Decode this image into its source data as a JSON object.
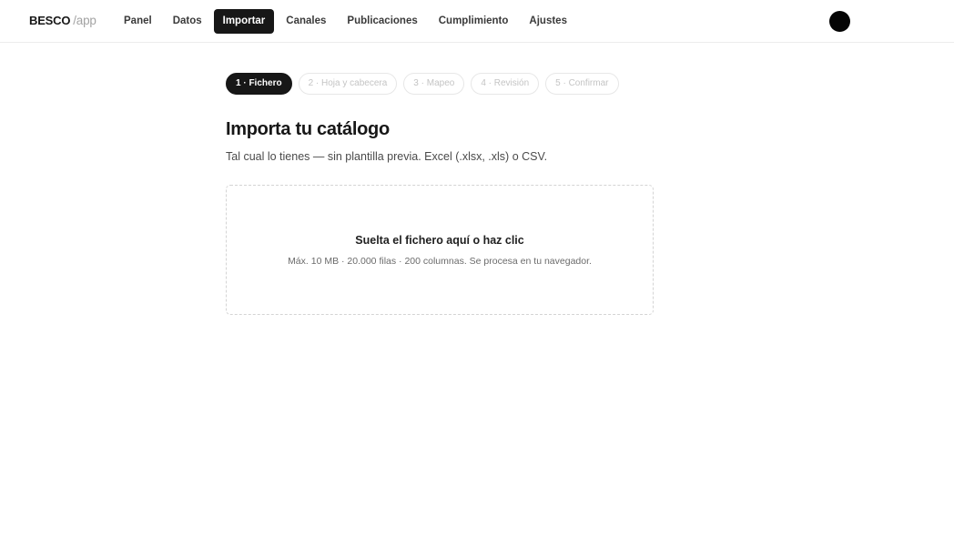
{
  "brand": {
    "name": "BESCO",
    "suffix": "/app"
  },
  "nav": {
    "items": [
      {
        "label": "Panel",
        "active": false
      },
      {
        "label": "Datos",
        "active": false
      },
      {
        "label": "Importar",
        "active": true
      },
      {
        "label": "Canales",
        "active": false
      },
      {
        "label": "Publicaciones",
        "active": false
      },
      {
        "label": "Cumplimiento",
        "active": false
      },
      {
        "label": "Ajustes",
        "active": false
      }
    ]
  },
  "steps": [
    {
      "label": "1 · Fichero",
      "active": true
    },
    {
      "label": "2 · Hoja y cabecera",
      "active": false
    },
    {
      "label": "3 · Mapeo",
      "active": false
    },
    {
      "label": "4 · Revisión",
      "active": false
    },
    {
      "label": "5 · Confirmar",
      "active": false
    }
  ],
  "main": {
    "title": "Importa tu catálogo",
    "subtitle": "Tal cual lo tienes — sin plantilla previa. Excel (.xlsx, .xls) o CSV."
  },
  "dropzone": {
    "title": "Suelta el fichero aquí o haz clic",
    "hint": "Máx. 10 MB · 20.000 filas · 200 columnas. Se procesa en tu navegador."
  },
  "colors": {
    "accent": "#171717",
    "muted": "#c4c4c4",
    "border": "#d4d4d4"
  }
}
